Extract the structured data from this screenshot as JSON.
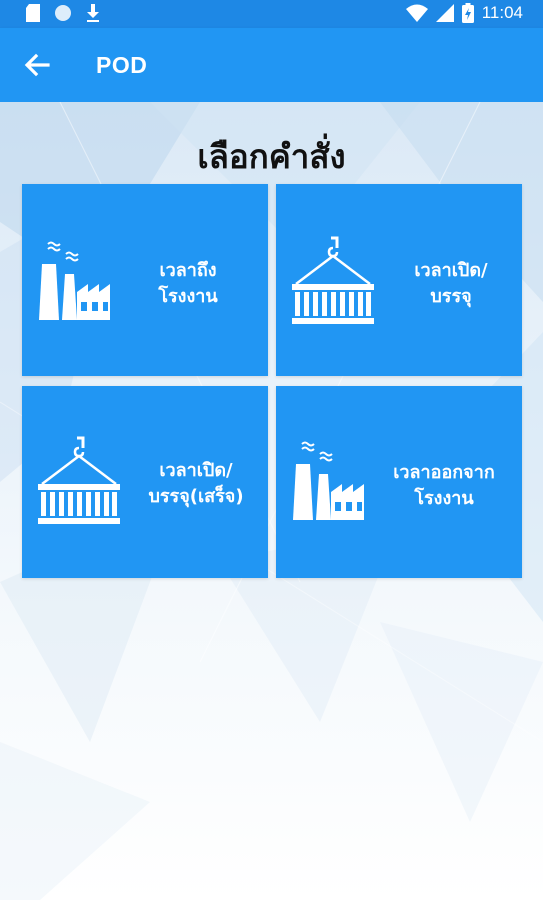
{
  "status_bar": {
    "time": "11:04",
    "left_icons": [
      "sd-card-icon",
      "circle-icon",
      "download-icon"
    ],
    "right_icons": [
      "wifi-icon",
      "signal-icon",
      "battery-icon"
    ]
  },
  "app_bar": {
    "back_icon": "arrow-left-icon",
    "title": "POD"
  },
  "main": {
    "heading": "เลือกคำสั่ง",
    "tiles": [
      {
        "icon": "factory-icon",
        "line1": "เวลาถึง",
        "line2": "โรงงาน"
      },
      {
        "icon": "container-icon",
        "line1": "เวลาเปิด/",
        "line2": "บรรจุ"
      },
      {
        "icon": "container-icon",
        "line1": "เวลาเปิด/",
        "line2": "บรรจุ(เสร็จ)"
      },
      {
        "icon": "factory-icon",
        "line1": "เวลาออกจาก",
        "line2": "โรงงาน"
      }
    ]
  },
  "colors": {
    "status_bar": "#1e88e5",
    "app_bar": "#2196f3",
    "tile": "#2196f3",
    "text_on_blue": "#ffffff",
    "heading": "#111111"
  }
}
